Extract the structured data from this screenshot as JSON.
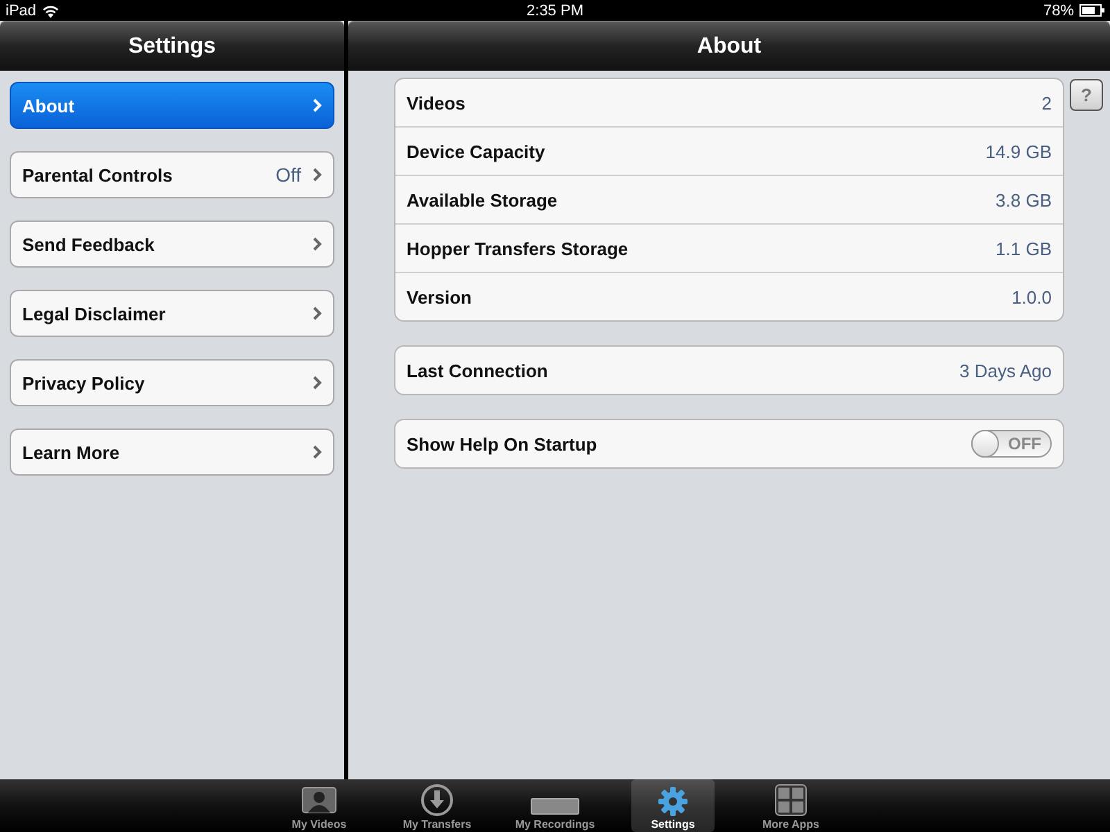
{
  "status_bar": {
    "device": "iPad",
    "time": "2:35 PM",
    "battery": "78%"
  },
  "sidebar": {
    "title": "Settings",
    "items": [
      {
        "label": "About",
        "selected": true
      },
      {
        "label": "Parental Controls",
        "value": "Off",
        "selected": false
      },
      {
        "label": "Send Feedback",
        "selected": false
      },
      {
        "label": "Legal Disclaimer",
        "selected": false
      },
      {
        "label": "Privacy Policy",
        "selected": false
      },
      {
        "label": "Learn More",
        "selected": false
      }
    ]
  },
  "detail": {
    "title": "About",
    "help": "?",
    "groups": [
      {
        "rows": [
          {
            "label": "Videos",
            "value": "2"
          },
          {
            "label": "Device Capacity",
            "value": "14.9 GB"
          },
          {
            "label": "Available Storage",
            "value": "3.8 GB"
          },
          {
            "label": "Hopper Transfers Storage",
            "value": "1.1 GB"
          },
          {
            "label": "Version",
            "value": "1.0.0"
          }
        ]
      },
      {
        "rows": [
          {
            "label": "Last Connection",
            "value": "3 Days Ago"
          }
        ]
      },
      {
        "rows": [
          {
            "label": "Show Help On Startup",
            "kind": "toggle",
            "on": false,
            "state_text": "OFF"
          }
        ]
      }
    ]
  },
  "tab_bar": [
    {
      "label": "My Videos",
      "kind": "monitor",
      "selected": false
    },
    {
      "label": "My Transfers",
      "kind": "download",
      "selected": false
    },
    {
      "label": "My Recordings",
      "kind": "receiver",
      "selected": false
    },
    {
      "label": "Settings",
      "kind": "gear",
      "selected": true
    },
    {
      "label": "More Apps",
      "kind": "grid",
      "selected": false
    }
  ]
}
